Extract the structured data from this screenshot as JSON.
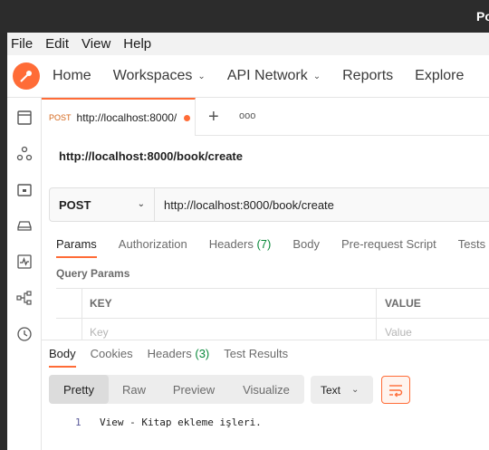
{
  "window": {
    "title": "Po"
  },
  "menu": [
    "File",
    "Edit",
    "View",
    "Help"
  ],
  "nav": {
    "home": "Home",
    "workspaces": "Workspaces",
    "api_network": "API Network",
    "reports": "Reports",
    "explore": "Explore"
  },
  "tab": {
    "method": "POST",
    "url": "http://localhost:8000/",
    "add": "+",
    "more": "ooo"
  },
  "request": {
    "title": "http://localhost:8000/book/create",
    "method": "POST",
    "url": "http://localhost:8000/book/create"
  },
  "subtabs": {
    "params": "Params",
    "authorization": "Authorization",
    "headers": "Headers",
    "headers_count": "(7)",
    "body": "Body",
    "prerequest": "Pre-request Script",
    "tests": "Tests"
  },
  "params": {
    "section_title": "Query Params",
    "col_key": "KEY",
    "col_value": "VALUE",
    "key_placeholder": "Key",
    "value_placeholder": "Value"
  },
  "response": {
    "tabs": {
      "body": "Body",
      "cookies": "Cookies",
      "headers": "Headers",
      "headers_count": "(3)",
      "test_results": "Test Results"
    },
    "formats": [
      "Pretty",
      "Raw",
      "Preview",
      "Visualize"
    ],
    "language": "Text",
    "line_number": "1",
    "line_text": "View - Kitap ekleme işleri."
  },
  "colors": {
    "accent": "#ff6c37",
    "count_green": "#0a8a3b"
  }
}
